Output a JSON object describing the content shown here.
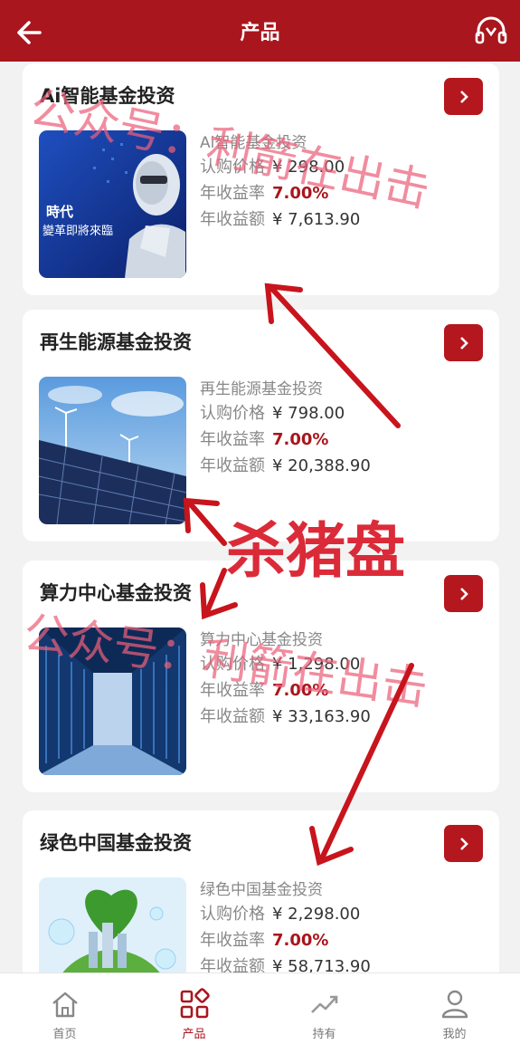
{
  "header": {
    "title": "产品",
    "back_icon": "arrow-left-icon",
    "support_icon": "headset-icon"
  },
  "products": [
    {
      "title": "Ai智能基金投资",
      "subtitle": "Ai智能基金投资",
      "price_label": "认购价格",
      "price": "¥ 298.00",
      "rate_label": "年收益率",
      "rate": "7.00%",
      "income_label": "年收益额",
      "income": "¥ 7,613.90",
      "image": "ai-robot-image",
      "image_text_1": "時代",
      "image_text_2": "變革即將來臨"
    },
    {
      "title": "再生能源基金投资",
      "subtitle": "再生能源基金投资",
      "price_label": "认购价格",
      "price": "¥ 798.00",
      "rate_label": "年收益率",
      "rate": "7.00%",
      "income_label": "年收益额",
      "income": "¥ 20,388.90",
      "image": "solar-panels-image"
    },
    {
      "title": "算力中心基金投资",
      "subtitle": "算力中心基金投资",
      "price_label": "认购价格",
      "price": "¥ 1,298.00",
      "rate_label": "年收益率",
      "rate": "7.00%",
      "income_label": "年收益额",
      "income": "¥ 33,163.90",
      "image": "data-center-image"
    },
    {
      "title": "绿色中国基金投资",
      "subtitle": "绿色中国基金投资",
      "price_label": "认购价格",
      "price": "¥ 2,298.00",
      "rate_label": "年收益率",
      "rate": "7.00%",
      "income_label": "年收益额",
      "income": "¥ 58,713.90",
      "image": "green-earth-image"
    }
  ],
  "tabbar": [
    {
      "label": "首页",
      "icon": "home-icon",
      "active": false
    },
    {
      "label": "产品",
      "icon": "grid-icon",
      "active": true
    },
    {
      "label": "持有",
      "icon": "trend-icon",
      "active": false
    },
    {
      "label": "我的",
      "icon": "user-icon",
      "active": false
    }
  ],
  "watermarks": {
    "account_1": "公众号：利箭在出击",
    "scam": "杀猪盘",
    "account_2": "公众号：利箭在出击"
  },
  "colors": {
    "brand": "#a9161d",
    "button": "#b5171e",
    "background": "#f2f2f2",
    "watermark_pink": "#eb607a",
    "annotation_red": "#c8141c"
  }
}
